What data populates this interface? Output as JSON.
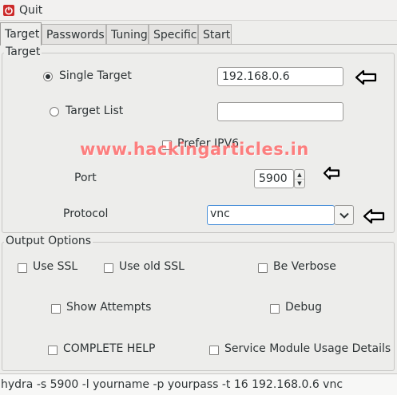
{
  "menubar": {
    "quit_label": "Quit",
    "quit_icon": "quit-icon"
  },
  "tabs": [
    {
      "label": "Target",
      "active": true
    },
    {
      "label": "Passwords"
    },
    {
      "label": "Tuning"
    },
    {
      "label": "Specific"
    },
    {
      "label": "Start"
    }
  ],
  "target_group": {
    "title": "Target",
    "single_target_label": "Single Target",
    "single_target_selected": true,
    "single_target_value": "192.168.0.6",
    "target_list_label": "Target List",
    "target_list_value": "",
    "prefer_ipv6_label": "Prefer IPV6",
    "port_label": "Port",
    "port_value": "5900",
    "protocol_label": "Protocol",
    "protocol_value": "vnc"
  },
  "watermark": "www.hackingarticles.in",
  "output_options": {
    "title": "Output Options",
    "use_ssl": "Use SSL",
    "use_old_ssl": "Use old SSL",
    "be_verbose": "Be Verbose",
    "show_attempts": "Show Attempts",
    "debug": "Debug",
    "complete_help": "COMPLETE HELP",
    "service_module_usage": "Service Module Usage Details"
  },
  "status": {
    "command": "hydra -s 5900 -l yourname -p yourpass -t 16 192.168.0.6 vnc"
  },
  "colors": {
    "accent": "#4a90d9",
    "quit_icon": "#cc2a2a",
    "watermark": "#ff6b6b"
  }
}
